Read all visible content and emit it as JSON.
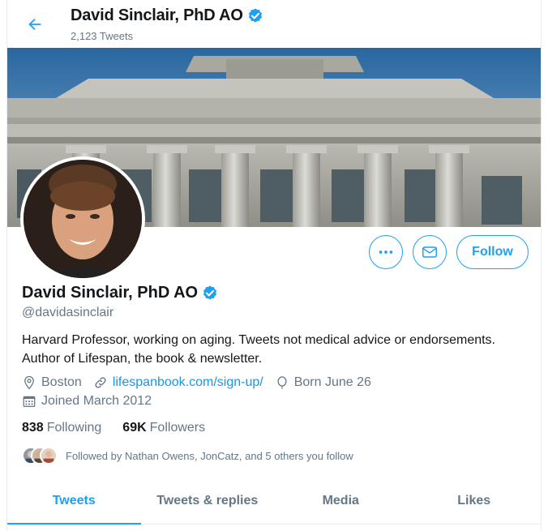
{
  "header": {
    "title": "David Sinclair, PhD AO",
    "tweet_count": "2,123 Tweets"
  },
  "profile": {
    "name": "David Sinclair, PhD AO",
    "handle": "@davidasinclair",
    "bio": "Harvard Professor, working on aging. Tweets not medical advice or endorsements. Author of Lifespan, the book & newsletter.",
    "location": "Boston",
    "website": "lifespanbook.com/sign-up/",
    "birthday": "Born June 26",
    "joined": "Joined March 2012",
    "verified": true
  },
  "actions": {
    "follow_label": "Follow"
  },
  "stats": {
    "following_count": "838",
    "following_label": "Following",
    "followers_count": "69K",
    "followers_label": "Followers"
  },
  "followed_by": "Followed by Nathan Owens, JonCatz, and 5 others you follow",
  "tabs": [
    {
      "label": "Tweets",
      "active": true
    },
    {
      "label": "Tweets & replies",
      "active": false
    },
    {
      "label": "Media",
      "active": false
    },
    {
      "label": "Likes",
      "active": false
    }
  ],
  "colors": {
    "accent": "#1da1f2",
    "secondary_text": "#657786",
    "link": "#1b95e0"
  }
}
